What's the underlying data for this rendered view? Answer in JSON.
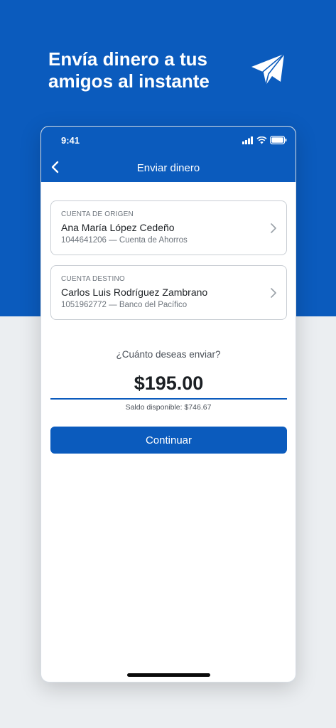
{
  "hero": {
    "title": "Envía dinero a tus amigos al instante",
    "icon": "paper-plane-icon",
    "background_color": "#0b5bbd"
  },
  "status_bar": {
    "time": "9:41",
    "icons": [
      "signal-icon",
      "wifi-icon",
      "battery-icon"
    ]
  },
  "nav": {
    "title": "Enviar dinero",
    "back_icon": "chevron-left-icon"
  },
  "origin": {
    "label": "CUENTA DE ORIGEN",
    "name": "Ana María López Cedeño",
    "detail": "1044641206 — Cuenta de Ahorros"
  },
  "destination": {
    "label": "CUENTA DESTINO",
    "name": "Carlos Luis Rodríguez Zambrano",
    "detail": "1051962772 — Banco del Pacífico"
  },
  "transfer": {
    "question": "¿Cuánto deseas enviar?",
    "amount": "$195.00",
    "balance": "Saldo disponible: $746.67"
  },
  "actions": {
    "continue_label": "Continuar"
  },
  "colors": {
    "primary": "#0b5bbd",
    "page_background": "#ebeef1"
  }
}
